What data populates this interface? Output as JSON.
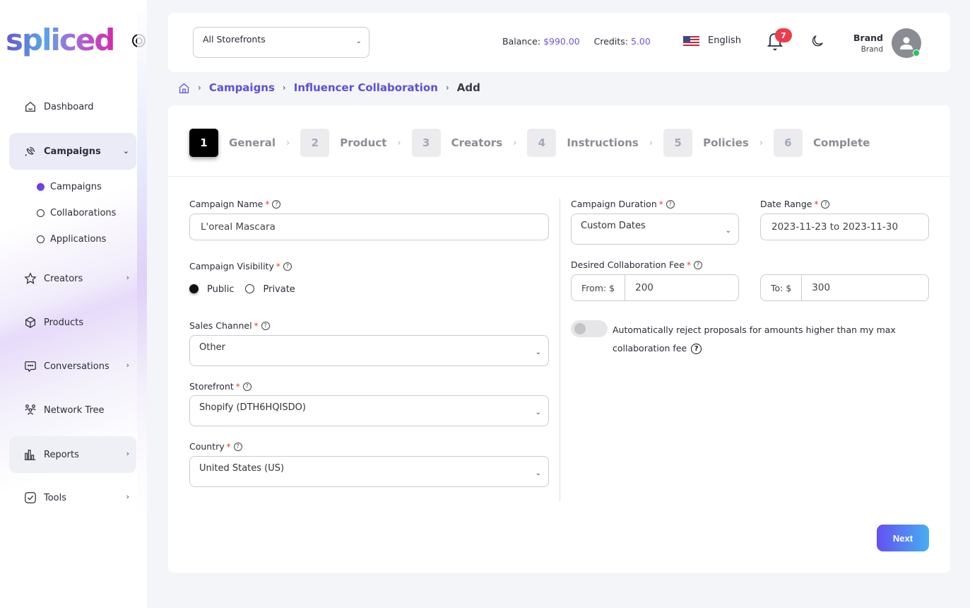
{
  "brand": {
    "logo_text": "spliced"
  },
  "sidebar": {
    "items": [
      {
        "label": "Dashboard",
        "icon": "home-icon"
      },
      {
        "label": "Campaigns",
        "icon": "megaphone-icon",
        "expanded": true,
        "children": [
          {
            "label": "Campaigns",
            "active": true
          },
          {
            "label": "Collaborations",
            "active": false
          },
          {
            "label": "Applications",
            "active": false
          }
        ]
      },
      {
        "label": "Creators",
        "icon": "star-icon"
      },
      {
        "label": "Products",
        "icon": "box-icon"
      },
      {
        "label": "Conversations",
        "icon": "chat-icon"
      },
      {
        "label": "Network Tree",
        "icon": "users-icon"
      },
      {
        "label": "Reports",
        "icon": "bar-chart-icon"
      },
      {
        "label": "Tools",
        "icon": "check-square-icon"
      }
    ]
  },
  "header": {
    "storefront_select": "All Storefronts",
    "balance_label": "Balance:",
    "balance_value": "$990.00",
    "credits_label": "Credits:",
    "credits_value": "5.00",
    "language": "English",
    "notification_count": "7",
    "user_name": "Brand",
    "user_role": "Brand"
  },
  "breadcrumb": {
    "items": [
      "Campaigns",
      "Influencer Collaboration"
    ],
    "current": "Add"
  },
  "steps": [
    {
      "num": "1",
      "label": "General",
      "active": true
    },
    {
      "num": "2",
      "label": "Product",
      "active": false
    },
    {
      "num": "3",
      "label": "Creators",
      "active": false
    },
    {
      "num": "4",
      "label": "Instructions",
      "active": false
    },
    {
      "num": "5",
      "label": "Policies",
      "active": false
    },
    {
      "num": "6",
      "label": "Complete",
      "active": false
    }
  ],
  "form": {
    "campaign_name": {
      "label": "Campaign Name",
      "value": "L'oreal Mascara"
    },
    "visibility": {
      "label": "Campaign Visibility",
      "options": [
        "Public",
        "Private"
      ],
      "selected": "Public"
    },
    "sales_channel": {
      "label": "Sales Channel",
      "value": "Other"
    },
    "storefront": {
      "label": "Storefront",
      "value": "Shopify (DTH6HQISDO)"
    },
    "country": {
      "label": "Country",
      "value": "United States (US)"
    },
    "duration": {
      "label": "Campaign Duration",
      "value": "Custom Dates"
    },
    "date_range": {
      "label": "Date Range",
      "value": "2023-11-23 to 2023-11-30"
    },
    "fee": {
      "label": "Desired Collaboration Fee",
      "from_prefix": "From: $",
      "from_value": "200",
      "to_prefix": "To: $",
      "to_value": "300"
    },
    "auto_reject": {
      "label": "Automatically reject proposals for amounts higher than my max collaboration fee",
      "enabled": false
    },
    "required_mark": "*",
    "help_glyph": "?"
  },
  "actions": {
    "next_label": "Next"
  },
  "colors": {
    "accent": "#5b4fe0",
    "badge": "#ee3b4c",
    "online": "#22c55e"
  }
}
